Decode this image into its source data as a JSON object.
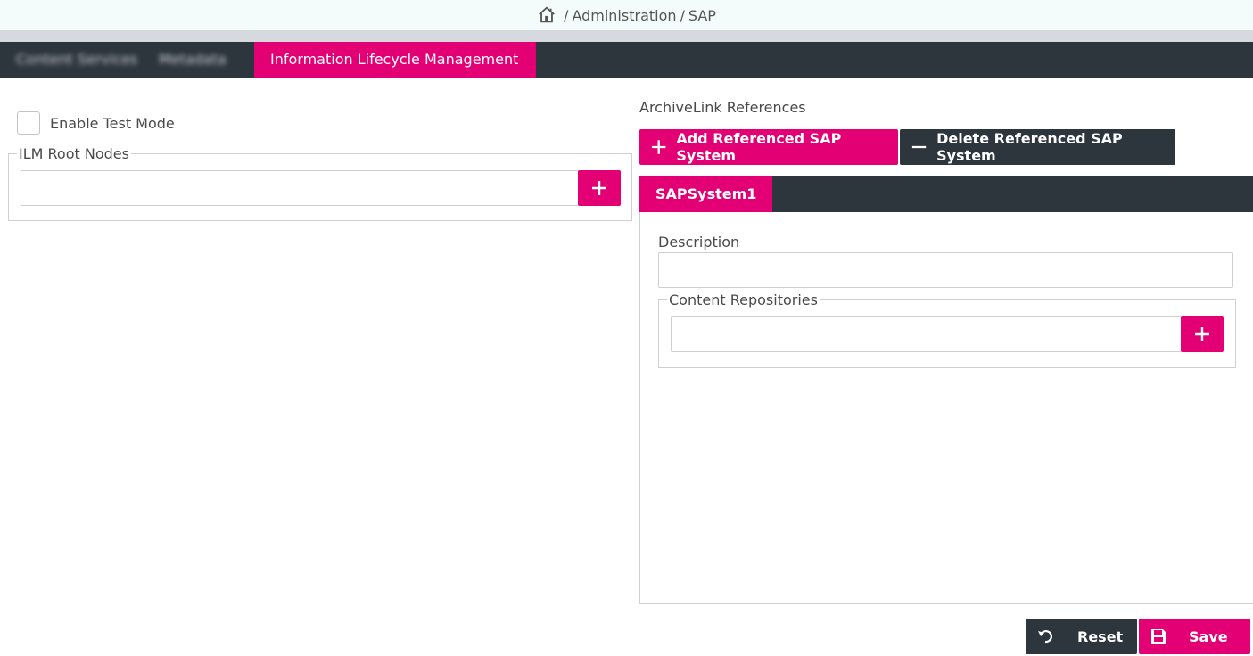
{
  "breadcrumb": {
    "sep1": "/",
    "item1": "Administration",
    "sep2": "/",
    "item2": "SAP"
  },
  "tabs": [
    {
      "label": "Content Services",
      "state": "blurred"
    },
    {
      "label": "Metadata",
      "state": "blurred"
    },
    {
      "label": "Information Lifecycle Management",
      "state": "active"
    }
  ],
  "left": {
    "test_mode_label": "Enable Test Mode",
    "test_mode_checked": false,
    "ilm_root_nodes_legend": "ILM Root Nodes",
    "ilm_root_nodes_value": ""
  },
  "right": {
    "section_title": "ArchiveLink References",
    "add_button_label": "Add Referenced SAP System",
    "delete_button_label": "Delete Referenced SAP System",
    "systems": [
      {
        "label": "SAPSystem1"
      }
    ],
    "description_label": "Description",
    "description_value": "",
    "content_repositories_legend": "Content Repositories",
    "content_repositories_value": ""
  },
  "footer": {
    "reset_label": "Reset",
    "save_label": "Save"
  },
  "colors": {
    "accent": "#e20074",
    "dark": "#2d353d"
  },
  "icons": [
    "home-icon",
    "plus-icon",
    "minus-icon",
    "undo-icon",
    "save-icon"
  ]
}
